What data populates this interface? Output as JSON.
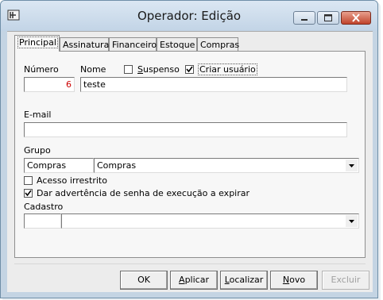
{
  "window": {
    "title": "Operador: Edição"
  },
  "tabs": [
    "Principal",
    "Assinatura",
    "Financeiro",
    "Estoque",
    "Compras"
  ],
  "form": {
    "numero_label": "Número",
    "numero_value": "6",
    "nome_label": "Nome",
    "nome_value": "teste",
    "suspenso_label": "Suspenso",
    "suspenso_checked": false,
    "criar_usuario_label": "Criar usuário",
    "criar_usuario_checked": true,
    "email_label": "E-mail",
    "email_value": "",
    "grupo_label": "Grupo",
    "grupo_code": "Compras",
    "grupo_select": "Compras",
    "acesso_label": "Acesso irrestrito",
    "acesso_checked": false,
    "advertencia_label": "Dar advertência de senha de execução a expirar",
    "advertencia_checked": true,
    "cadastro_label": "Cadastro",
    "cadastro_code": "",
    "cadastro_select": ""
  },
  "buttons": {
    "ok": "OK",
    "aplicar": "Aplicar",
    "localizar": "Localizar",
    "novo": "Novo",
    "excluir": "Excluir"
  },
  "icons": {
    "app": "app-icon",
    "minimize": "minimize-icon",
    "maximize": "maximize-icon",
    "close": "close-icon"
  },
  "colors": {
    "numero_value": "#cc0000",
    "titlebar": "#c4d4e3",
    "close_button": "#c0442c"
  }
}
